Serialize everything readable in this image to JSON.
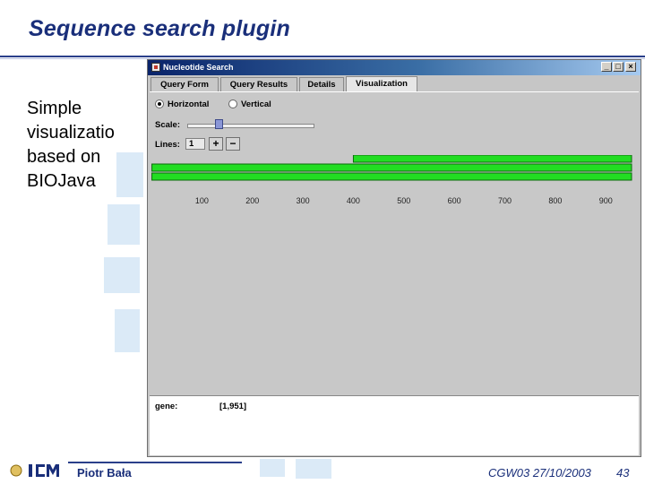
{
  "slide": {
    "title": "Sequence search plugin",
    "bullet_lines": [
      "Simple",
      "visualizatio",
      "based on",
      "BIOJava"
    ]
  },
  "window": {
    "title": "Nucleotide Search",
    "controls": {
      "minimize": "_",
      "maximize": "□",
      "close": "×"
    },
    "tabs": [
      {
        "label": "Query Form",
        "active": false
      },
      {
        "label": "Query Results",
        "active": false
      },
      {
        "label": "Details",
        "active": false
      },
      {
        "label": "Visualization",
        "active": true
      }
    ],
    "orientation": {
      "horizontal_label": "Horizontal",
      "vertical_label": "Vertical",
      "selected": "horizontal"
    },
    "scale": {
      "label": "Scale:",
      "level": 0.25
    },
    "lines": {
      "label": "Lines:",
      "value": "1",
      "add_label": "+",
      "remove_label": "−"
    },
    "axis": {
      "ticks": [
        "100",
        "200",
        "300",
        "400",
        "500",
        "600",
        "700",
        "800",
        "900"
      ],
      "max": 951
    },
    "tracks": [
      {
        "start": 400,
        "end": 951,
        "color": "#22dd22"
      },
      {
        "start": 1,
        "end": 951,
        "color": "#22dd22"
      },
      {
        "start": 1,
        "end": 951,
        "color": "#22dd22"
      }
    ],
    "gene": {
      "label": "gene:",
      "value": "[1,951]"
    }
  },
  "footer": {
    "author": "Piotr Bała",
    "event": "CGW03 27/10/2003",
    "page": "43"
  },
  "colors": {
    "accent": "#1a2f7a",
    "track": "#22dd22",
    "watermark": "#dbeaf7"
  }
}
